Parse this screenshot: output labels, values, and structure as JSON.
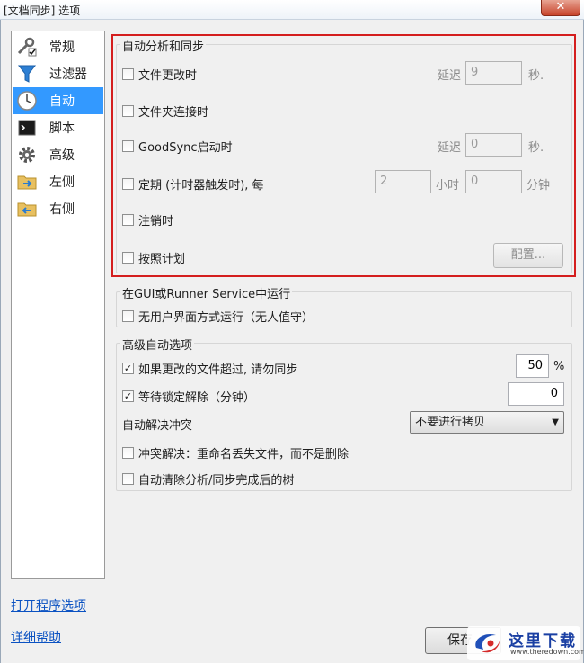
{
  "window": {
    "title": "[文档同步] 选项",
    "close_glyph": "✕"
  },
  "sidebar": {
    "items": [
      {
        "label": "常规",
        "icon": "wrench-check-icon"
      },
      {
        "label": "过滤器",
        "icon": "funnel-icon"
      },
      {
        "label": "自动",
        "icon": "clock-icon",
        "active": true
      },
      {
        "label": "脚本",
        "icon": "console-icon"
      },
      {
        "label": "高级",
        "icon": "gear-icon"
      },
      {
        "label": "左侧",
        "icon": "folder-arrow-right-icon"
      },
      {
        "label": "右侧",
        "icon": "folder-arrow-left-icon"
      }
    ]
  },
  "links": {
    "program_options": "打开程序选项",
    "help": "详细帮助"
  },
  "auto_group": {
    "title": "自动分析和同步",
    "file_change": {
      "label": "文件更改时",
      "checked": false,
      "delay_label": "延迟",
      "delay_value": "9",
      "unit": "秒."
    },
    "folder_connect": {
      "label": "文件夹连接时",
      "checked": false
    },
    "on_start": {
      "label": "GoodSync启动时",
      "checked": false,
      "delay_label": "延迟",
      "delay_value": "0",
      "unit": "秒."
    },
    "periodic": {
      "label": "定期 (计时器触发时), 每",
      "checked": false,
      "hours_value": "2",
      "hours_unit": "小时",
      "minutes_value": "0",
      "minutes_unit": "分钟"
    },
    "logoff": {
      "label": "注销时",
      "checked": false
    },
    "schedule": {
      "label": "按照计划",
      "checked": false,
      "config_button": "配置..."
    }
  },
  "runner_group": {
    "title": "在GUI或Runner Service中运行",
    "unattended": {
      "label": "无用户界面方式运行（无人值守）",
      "checked": false
    }
  },
  "advanced_group": {
    "title": "高级自动选项",
    "too_many_changes": {
      "label": "如果更改的文件超过, 请勿同步",
      "checked": true,
      "value": "50",
      "unit": "%"
    },
    "wait_unlock": {
      "label": "等待锁定解除（分钟）",
      "checked": true,
      "value": "0"
    },
    "conflict": {
      "label": "自动解决冲突",
      "selected": "不要进行拷贝"
    },
    "rename_lost": {
      "label": "冲突解决：重命名丢失文件，而不是删除",
      "checked": false
    },
    "clear_tree": {
      "label": "自动清除分析/同步完成后的树",
      "checked": false
    }
  },
  "footer": {
    "save_label": "保存"
  },
  "watermark": {
    "brand": "这里下载",
    "url": "www.theredown.com"
  },
  "colors": {
    "accent": "#3399ff",
    "highlight_border": "#d41e1e",
    "link": "#0b52c2"
  }
}
